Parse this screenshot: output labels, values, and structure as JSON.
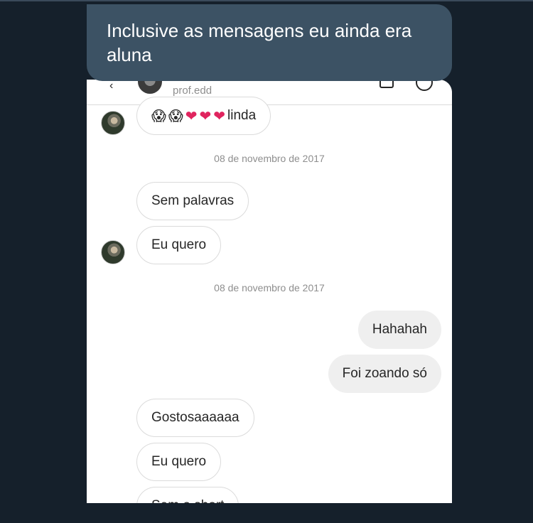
{
  "tweet": {
    "caption": "Inclusive as mensagens eu ainda era aluna"
  },
  "chat": {
    "header": {
      "username": "prof.edd"
    },
    "first_message": {
      "emojis": [
        "😱",
        "😱",
        "❤",
        "❤",
        "❤"
      ],
      "text": "linda"
    },
    "dates": [
      "08 de novembro de 2017",
      "08 de novembro de 2017"
    ],
    "messages_group1": [
      "Sem palavras",
      "Eu quero"
    ],
    "messages_outgoing": [
      "Hahahah",
      "Foi zoando só"
    ],
    "messages_group2": [
      "Gostosaaaaaa",
      "Eu quero",
      "Sem o short"
    ]
  }
}
